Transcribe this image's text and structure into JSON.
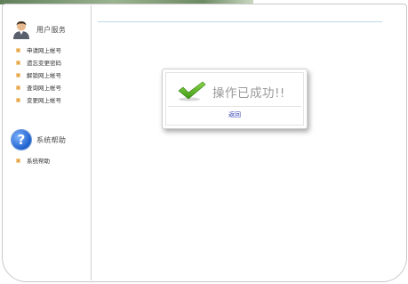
{
  "sidebar": {
    "user_service": {
      "title": "用户服务",
      "items": [
        {
          "label": "申请网上帐号"
        },
        {
          "label": "遗忘变更密码"
        },
        {
          "label": "解锁网上帐号"
        },
        {
          "label": "查询网上帐号"
        },
        {
          "label": "变更网上帐号"
        }
      ]
    },
    "system_help": {
      "title": "系统帮助",
      "items": [
        {
          "label": "系统帮助"
        }
      ]
    }
  },
  "dialog": {
    "message": "操作已成功!!",
    "back_link": "返回"
  },
  "colors": {
    "bullet": "#e6a64b",
    "link": "#2a3ab0",
    "check": "#4caf1e",
    "divider": "#bcd9e6"
  },
  "icons": {
    "user_avatar": "user-avatar-icon",
    "help": "help-question-icon",
    "success": "checkmark-icon"
  }
}
